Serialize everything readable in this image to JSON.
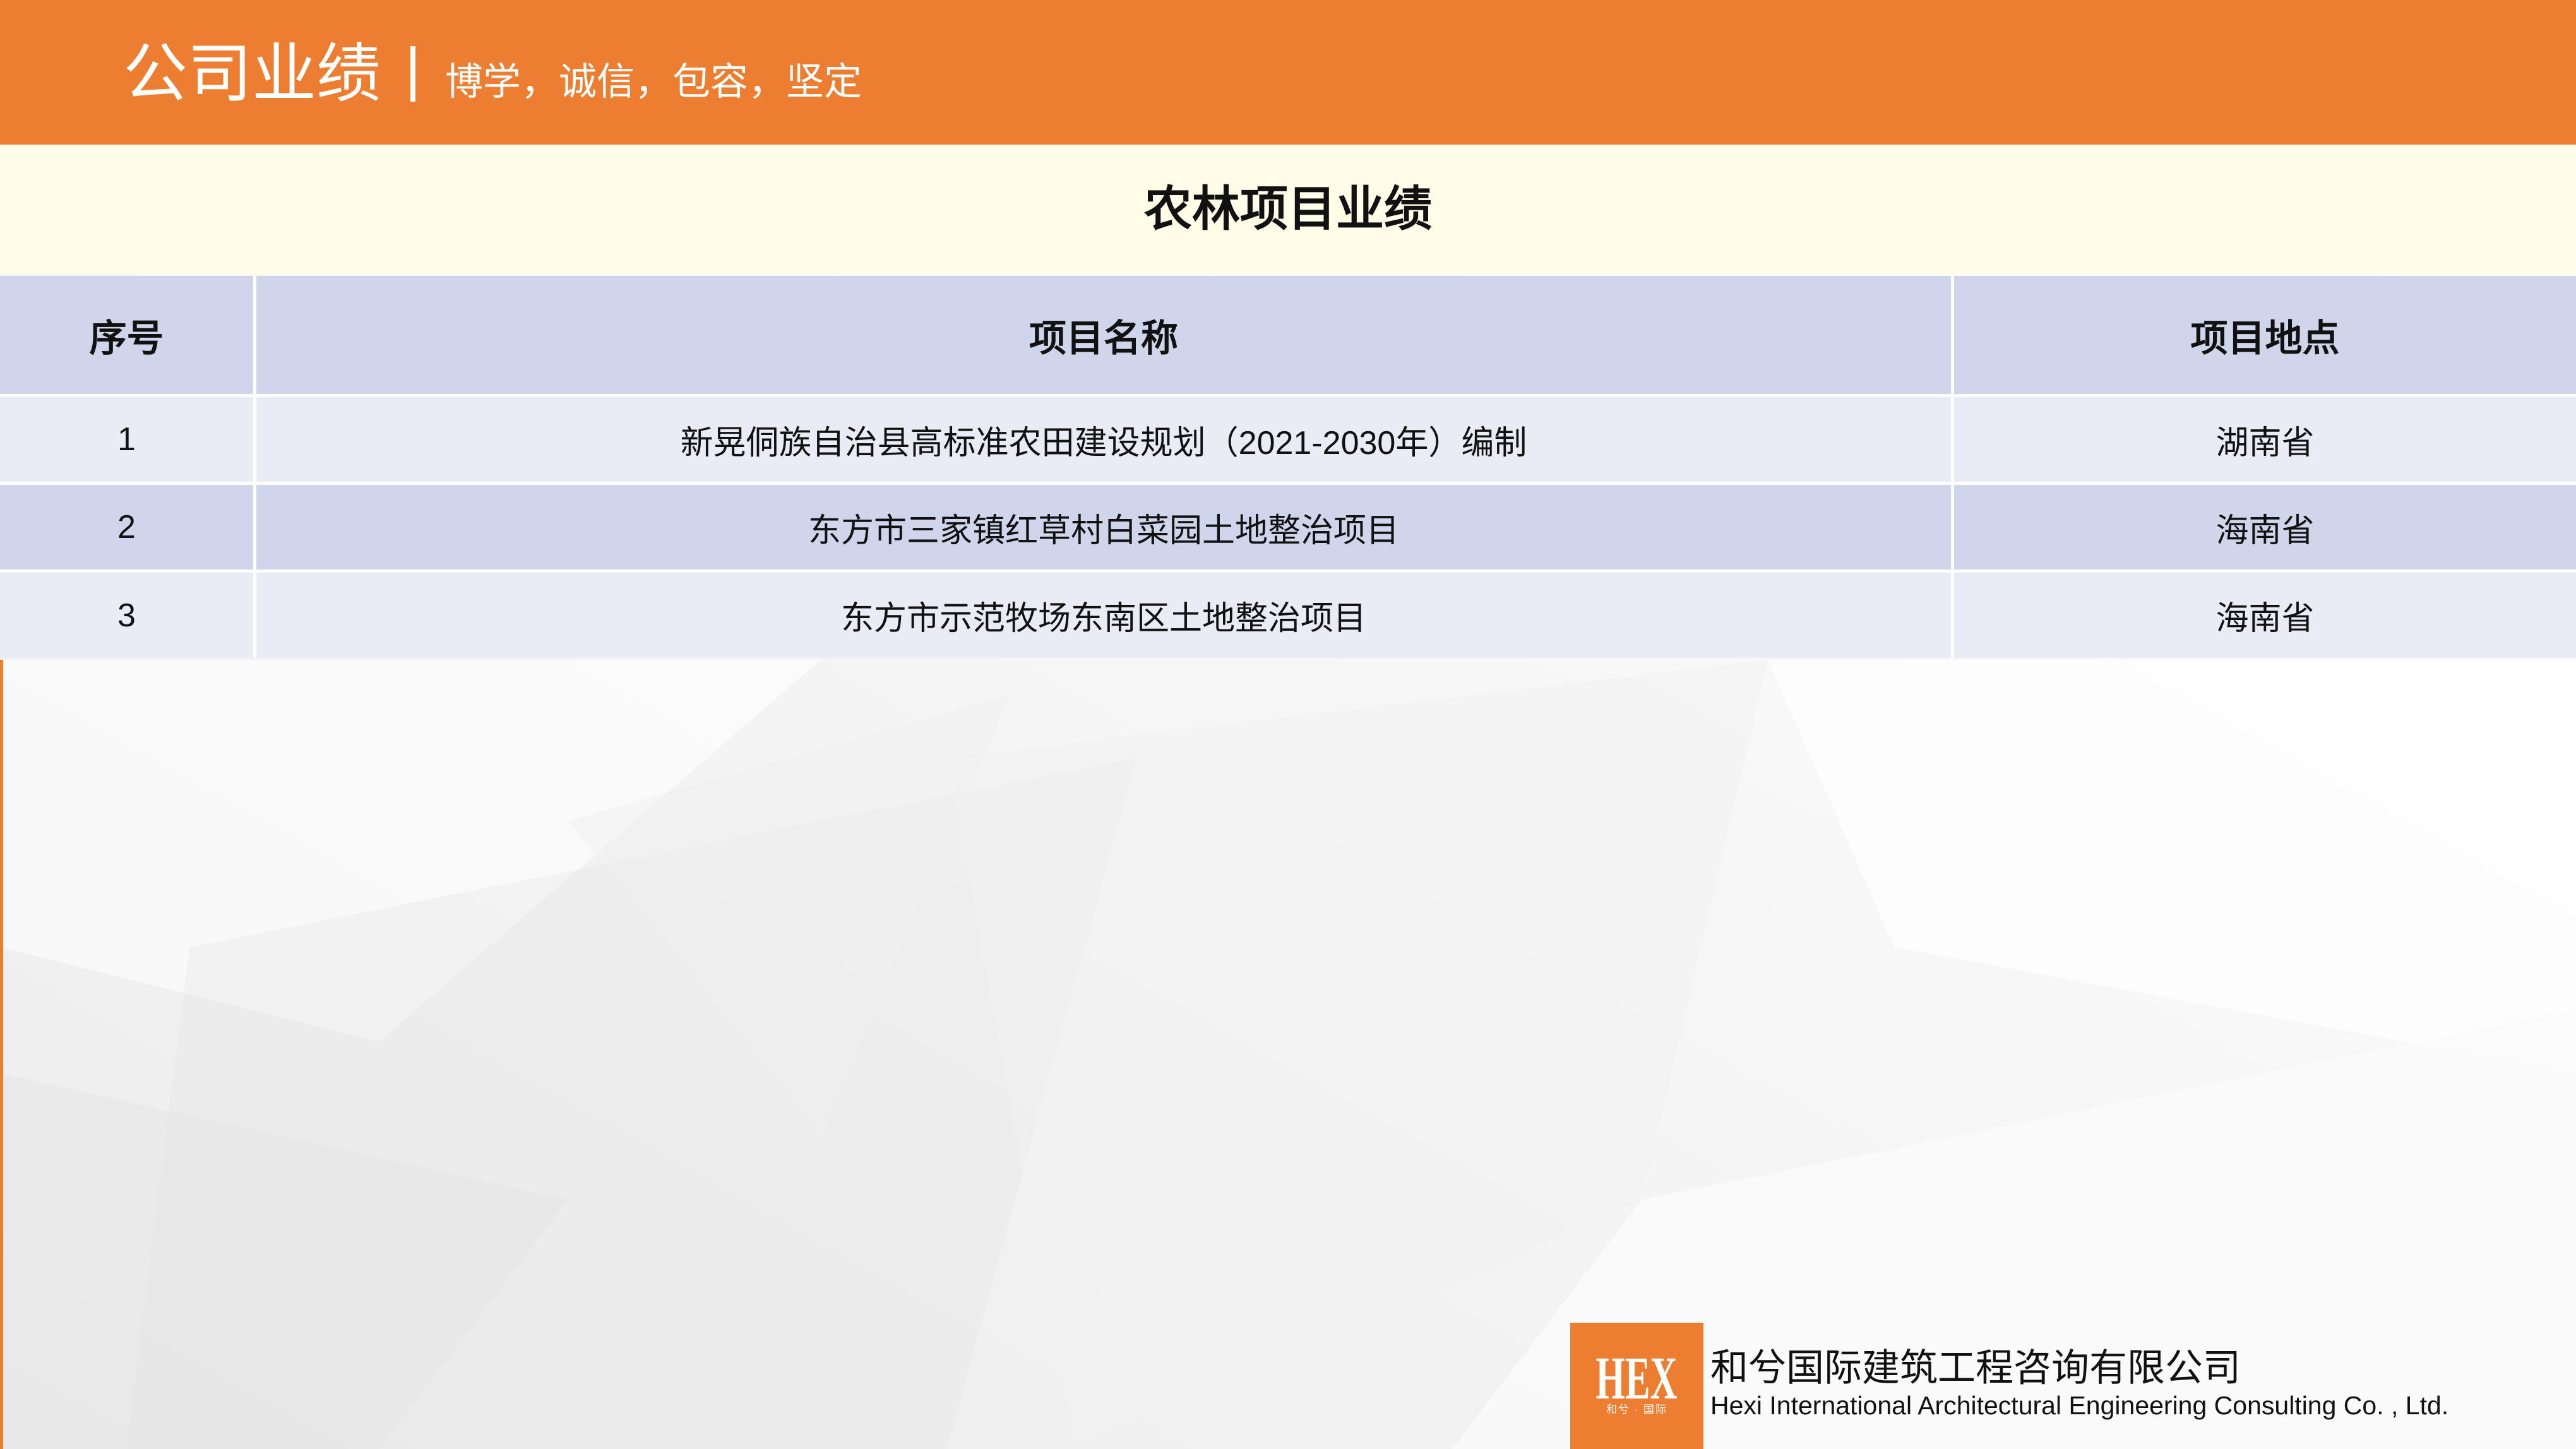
{
  "colors": {
    "accent": "#ED7D31",
    "header_text": "#FFFFFF",
    "band_background": "#FFFDE8",
    "table_header_background": "#CFD5EA",
    "table_row_light": "#E9EBF5",
    "table_row_dark": "#CFD5EA",
    "text": "#111111"
  },
  "header": {
    "title": "公司业绩",
    "slogan": "博学，诚信，包容，坚定"
  },
  "section": {
    "title": "农林项目业绩"
  },
  "table": {
    "columns": [
      "序号",
      "项目名称",
      "项目地点"
    ],
    "rows": [
      {
        "index": "1",
        "name": "新晃侗族自治县高标准农田建设规划（2021-2030年）编制",
        "location": "湖南省"
      },
      {
        "index": "2",
        "name": "东方市三家镇红草村白菜园土地整治项目",
        "location": "海南省"
      },
      {
        "index": "3",
        "name": "东方市示范牧场东南区土地整治项目",
        "location": "海南省"
      }
    ]
  },
  "footer": {
    "logo_text": "HEX",
    "logo_subtext": "和兮 · 国际",
    "company_cn": "和兮国际建筑工程咨询有限公司",
    "company_en": "Hexi International Architectural Engineering Consulting Co. , Ltd."
  }
}
